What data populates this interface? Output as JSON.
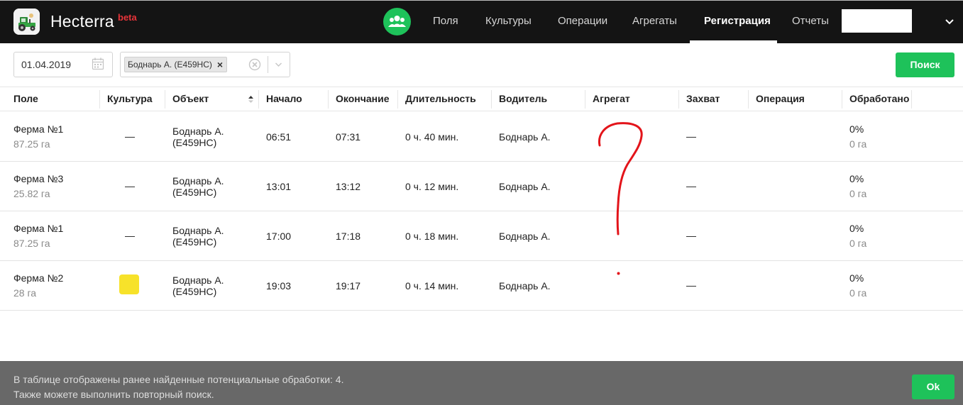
{
  "header": {
    "app_name": "Hecterra",
    "badge": "beta",
    "nav": [
      {
        "label": "Поля",
        "active": false
      },
      {
        "label": "Культуры",
        "active": false
      },
      {
        "label": "Операции",
        "active": false
      },
      {
        "label": "Агрегаты",
        "active": false
      },
      {
        "label": "Регистрация",
        "active": true
      },
      {
        "label": "Отчеты",
        "active": false
      }
    ],
    "icons": {
      "logo": "tractor-icon",
      "group": "users-icon",
      "user_menu": "chevron-down-icon"
    }
  },
  "filters": {
    "date": "01.04.2019",
    "driver_chip": "Боднарь А. (Е459НС)",
    "chip_remove": "×",
    "search_label": "Поиск"
  },
  "table": {
    "columns": [
      "Поле",
      "Культура",
      "Объект",
      "Начало",
      "Окончание",
      "Длительность",
      "Водитель",
      "Агрегат",
      "Захват",
      "Операция",
      "Обработано"
    ],
    "rows": [
      {
        "field": "Ферма №1",
        "area": "87.25 га",
        "culture": "—",
        "culture_color": null,
        "object_line1": "Боднарь А.",
        "object_line2": "(Е459НС)",
        "start": "06:51",
        "end": "07:31",
        "duration": "0 ч. 40 мин.",
        "driver": "Боднарь А.",
        "implement": "",
        "width": "—",
        "operation": "",
        "processed_pct": "0%",
        "processed_area": "0 га"
      },
      {
        "field": "Ферма №3",
        "area": "25.82 га",
        "culture": "—",
        "culture_color": null,
        "object_line1": "Боднарь А.",
        "object_line2": "(Е459НС)",
        "start": "13:01",
        "end": "13:12",
        "duration": "0 ч. 12 мин.",
        "driver": "Боднарь А.",
        "implement": "",
        "width": "—",
        "operation": "",
        "processed_pct": "0%",
        "processed_area": "0 га"
      },
      {
        "field": "Ферма №1",
        "area": "87.25 га",
        "culture": "—",
        "culture_color": null,
        "object_line1": "Боднарь А.",
        "object_line2": "(Е459НС)",
        "start": "17:00",
        "end": "17:18",
        "duration": "0 ч. 18 мин.",
        "driver": "Боднарь А.",
        "implement": "",
        "width": "—",
        "operation": "",
        "processed_pct": "0%",
        "processed_area": "0 га"
      },
      {
        "field": "Ферма №2",
        "area": "28 га",
        "culture": "",
        "culture_color": "#f7e22a",
        "object_line1": "Боднарь А.",
        "object_line2": "(Е459НС)",
        "start": "19:03",
        "end": "19:17",
        "duration": "0 ч. 14 мин.",
        "driver": "Боднарь А.",
        "implement": "",
        "width": "—",
        "operation": "",
        "processed_pct": "0%",
        "processed_area": "0 га"
      }
    ]
  },
  "notice": {
    "line1": "В таблице отображены ранее найденные потенциальные обработки: 4.",
    "line2": "Также можете выполнить повторный поиск.",
    "ok_label": "Ok"
  },
  "colors": {
    "accent": "#1ec25a",
    "topbar": "#141414",
    "beta": "#e8343a",
    "notice_bg": "#686868",
    "annotation": "#e3141a"
  }
}
